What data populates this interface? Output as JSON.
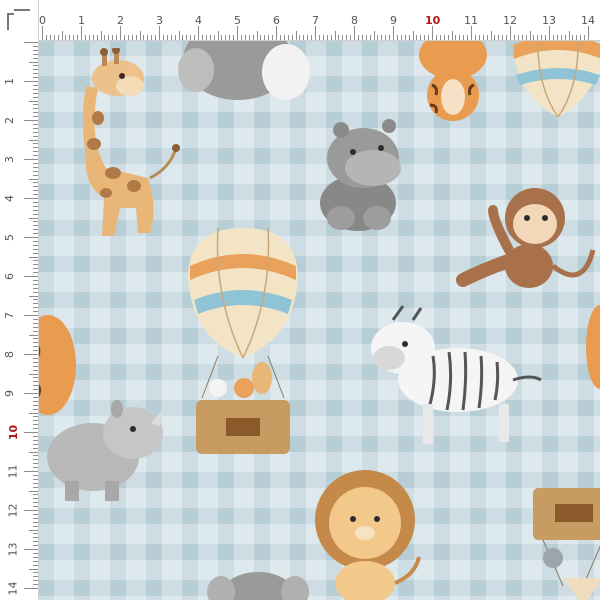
{
  "ruler": {
    "top_numbers": [
      "0",
      "1",
      "2",
      "3",
      "4",
      "5",
      "6",
      "7",
      "8",
      "9",
      "10",
      "11",
      "12",
      "13",
      "14"
    ],
    "left_numbers": [
      "1",
      "2",
      "3",
      "4",
      "5",
      "6",
      "7",
      "8",
      "9",
      "10",
      "11",
      "12",
      "13",
      "14"
    ],
    "highlight": "10",
    "highlight_color": "#b01818"
  },
  "fabric": {
    "background_color": "#dbe8ec",
    "gingham_color": "#b9cfd6",
    "animals": [
      "giraffe",
      "elephant",
      "tiger",
      "hot-air-balloon",
      "hippo",
      "monkey",
      "zebra",
      "rhino",
      "lion",
      "fox",
      "bunny",
      "crate"
    ]
  },
  "colors": {
    "orange": "#e9a15b",
    "light_blue": "#8fc3d6",
    "brown": "#b98a56",
    "grey": "#9a9a9a"
  }
}
